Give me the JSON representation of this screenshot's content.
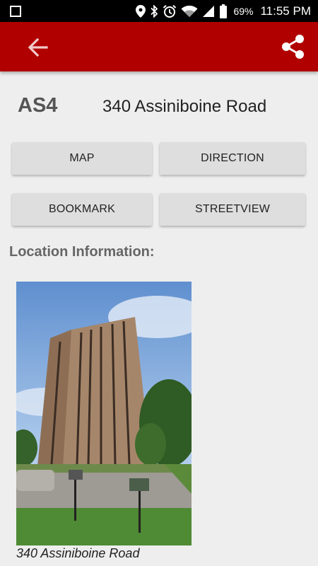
{
  "status_bar": {
    "battery_percent": "69%",
    "time": "11:55 PM",
    "icons": [
      "square-icon",
      "location-icon",
      "bluetooth-icon",
      "alarm-icon",
      "wifi-icon",
      "signal-icon",
      "battery-icon"
    ]
  },
  "app_bar": {
    "color": "#b00000",
    "icons": [
      "back-arrow-icon",
      "share-icon"
    ]
  },
  "location": {
    "code": "AS4",
    "address": "340 Assiniboine Road"
  },
  "buttons": {
    "map": "MAP",
    "direction": "DIRECTION",
    "bookmark": "BOOKMARK",
    "streetview": "STREETVIEW"
  },
  "section": {
    "heading": "Location Information:"
  },
  "photo": {
    "caption": "340 Assiniboine Road"
  }
}
